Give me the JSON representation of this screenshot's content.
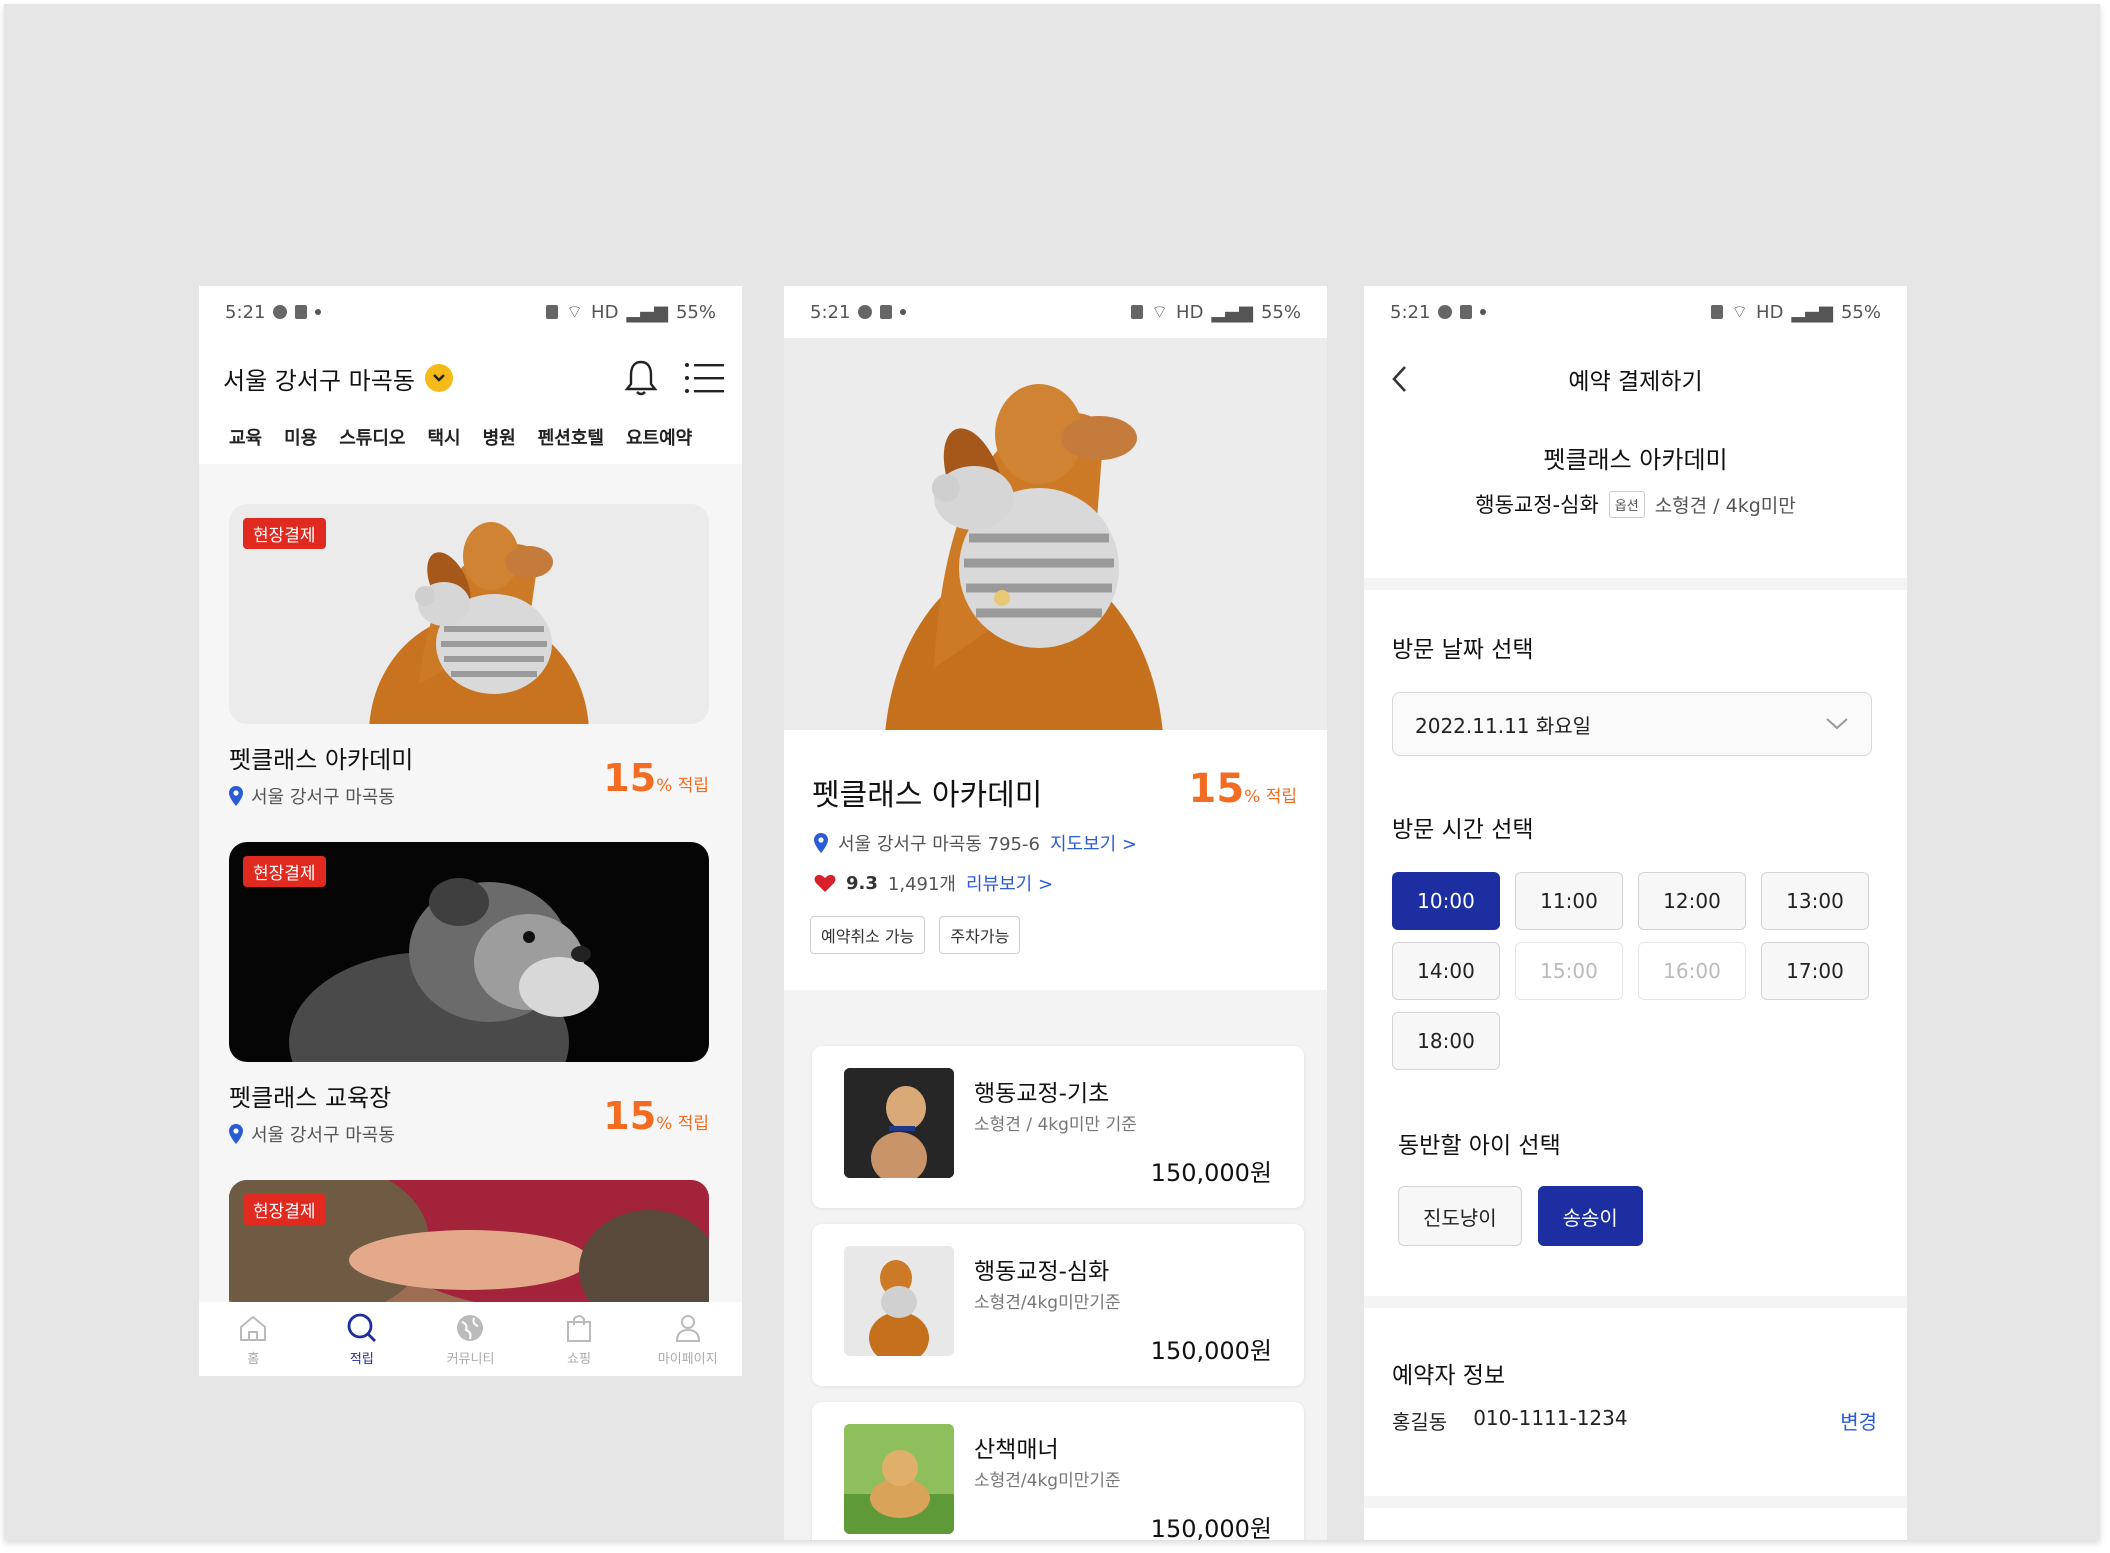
{
  "colors": {
    "primary": "#1c2ea0",
    "accent": "#f36c21",
    "badge": "#e02a1f",
    "link": "#2b5cd8",
    "location_chevron": "#f5b918"
  },
  "status_bar": {
    "time": "5:21",
    "hd": "HD",
    "battery": "55%"
  },
  "screen1": {
    "location": "서울 강서구 마곡동",
    "categories": [
      "교육",
      "미용",
      "스튜디오",
      "택시",
      "병원",
      "펜션호텔",
      "요트예약"
    ],
    "cards": [
      {
        "badge": "현장결제",
        "title": "펫클래스 아카데미",
        "address": "서울 강서구 마곡동",
        "percent": "15",
        "percent_unit": "% 적립"
      },
      {
        "badge": "현장결제",
        "title": "펫클래스 교육장",
        "address": "서울 강서구 마곡동",
        "percent": "15",
        "percent_unit": "% 적립"
      },
      {
        "badge": "현장결제"
      }
    ],
    "tabs": [
      {
        "label": "홈",
        "icon": "home-icon"
      },
      {
        "label": "적립",
        "icon": "search-icon",
        "active": true
      },
      {
        "label": "커뮤니티",
        "icon": "globe-icon"
      },
      {
        "label": "쇼핑",
        "icon": "shopping-bag-icon"
      },
      {
        "label": "마이페이지",
        "icon": "user-icon"
      }
    ]
  },
  "screen2": {
    "name": "펫클래스 아카데미",
    "percent": "15",
    "percent_unit": "% 적립",
    "address": "서울 강서구 마곡동 795-6",
    "map_link": "지도보기 >",
    "rating": "9.3",
    "review_count": "1,491개",
    "review_link": "리뷰보기 >",
    "tags": [
      "예약취소 가능",
      "주차가능"
    ],
    "services": [
      {
        "name": "행동교정-기초",
        "desc": "소형견 / 4kg미만 기준",
        "price": "150,000원"
      },
      {
        "name": "행동교정-심화",
        "desc": "소형견/4kg미만기준",
        "price": "150,000원"
      },
      {
        "name": "산책매너",
        "desc": "소형견/4kg미만기준",
        "price": "150,000원"
      }
    ]
  },
  "screen3": {
    "title": "예약 결제하기",
    "shop_name": "펫클래스 아카데미",
    "service": "행동교정-심화",
    "option_badge": "옵션",
    "option": "소형견 / 4kg미만",
    "date_title": "방문 날짜 선택",
    "date_value": "2022.11.11 화요일",
    "time_title": "방문 시간 선택",
    "times": [
      "10:00",
      "11:00",
      "12:00",
      "13:00",
      "14:00",
      "15:00",
      "16:00",
      "17:00",
      "18:00"
    ],
    "selected_time": "10:00",
    "disabled_times": [
      "15:00",
      "16:00"
    ],
    "pet_title": "동반할 아이 선택",
    "pets": [
      "진도냥이",
      "송송이"
    ],
    "selected_pet": "송송이",
    "reserver_title": "예약자 정보",
    "reserver_name": "홍길동",
    "reserver_phone": "010-1111-1234",
    "change_label": "변경"
  }
}
